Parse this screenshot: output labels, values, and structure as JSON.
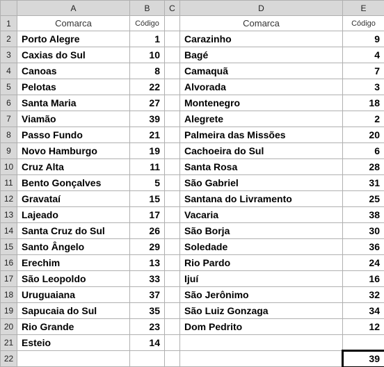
{
  "columns": {
    "A": "A",
    "B": "B",
    "C": "C",
    "D": "D",
    "E": "E"
  },
  "headers": {
    "comarca_a": "Comarca",
    "codigo_b": "Código",
    "comarca_d": "Comarca",
    "codigo_e": "Código"
  },
  "rows_left": [
    {
      "name": "Porto Alegre",
      "code": "1"
    },
    {
      "name": "Caxias do Sul",
      "code": "10"
    },
    {
      "name": "Canoas",
      "code": "8"
    },
    {
      "name": "Pelotas",
      "code": "22"
    },
    {
      "name": "Santa Maria",
      "code": "27"
    },
    {
      "name": "Viamão",
      "code": "39"
    },
    {
      "name": "Passo Fundo",
      "code": "21"
    },
    {
      "name": "Novo Hamburgo",
      "code": "19"
    },
    {
      "name": "Cruz Alta",
      "code": "11"
    },
    {
      "name": "Bento Gonçalves",
      "code": "5"
    },
    {
      "name": "Gravataí",
      "code": "15"
    },
    {
      "name": "Lajeado",
      "code": "17"
    },
    {
      "name": "Santa Cruz do Sul",
      "code": "26"
    },
    {
      "name": "Santo Ângelo",
      "code": "29"
    },
    {
      "name": "Erechim",
      "code": "13"
    },
    {
      "name": "São Leopoldo",
      "code": "33"
    },
    {
      "name": "Uruguaiana",
      "code": "37"
    },
    {
      "name": "Sapucaia do Sul",
      "code": "35"
    },
    {
      "name": "Rio Grande",
      "code": "23"
    },
    {
      "name": "Esteio",
      "code": "14"
    }
  ],
  "rows_right": [
    {
      "name": "Carazinho",
      "code": "9"
    },
    {
      "name": "Bagé",
      "code": "4"
    },
    {
      "name": "Camaquã",
      "code": "7"
    },
    {
      "name": "Alvorada",
      "code": "3"
    },
    {
      "name": "Montenegro",
      "code": "18"
    },
    {
      "name": "Alegrete",
      "code": "2"
    },
    {
      "name": "Palmeira das Missões",
      "code": "20"
    },
    {
      "name": "Cachoeira do Sul",
      "code": "6"
    },
    {
      "name": "Santa Rosa",
      "code": "28"
    },
    {
      "name": "São Gabriel",
      "code": "31"
    },
    {
      "name": "Santana do Livramento",
      "code": "25"
    },
    {
      "name": "Vacaria",
      "code": "38"
    },
    {
      "name": "São Borja",
      "code": "30"
    },
    {
      "name": "Soledade",
      "code": "36"
    },
    {
      "name": "Rio Pardo",
      "code": "24"
    },
    {
      "name": "Ijuí",
      "code": "16"
    },
    {
      "name": "São Jerônimo",
      "code": "32"
    },
    {
      "name": "São Luiz Gonzaga",
      "code": "34"
    },
    {
      "name": "Dom Pedrito",
      "code": "12"
    }
  ],
  "row_numbers": [
    "1",
    "2",
    "3",
    "4",
    "5",
    "6",
    "7",
    "8",
    "9",
    "10",
    "11",
    "12",
    "13",
    "14",
    "15",
    "16",
    "17",
    "18",
    "19",
    "20",
    "21",
    "22"
  ],
  "selected_cell": {
    "row": 22,
    "col": "E",
    "value": "39"
  }
}
